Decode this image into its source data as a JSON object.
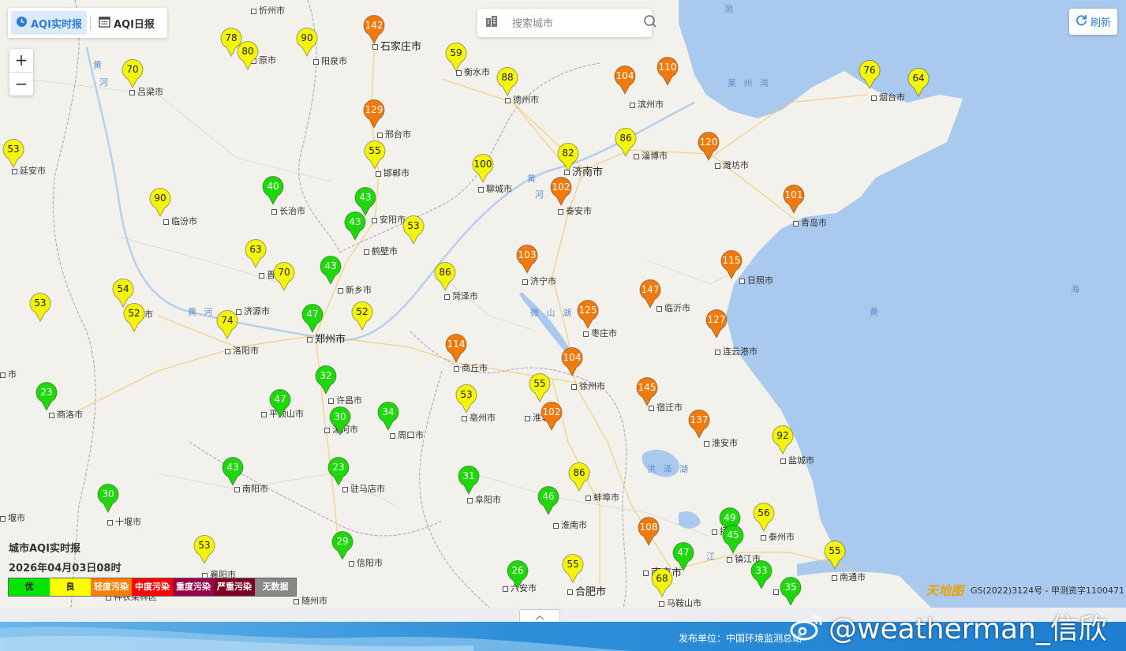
{
  "tabs": {
    "realtime": "AQI实时报",
    "daily": "AQI日报"
  },
  "search": {
    "placeholder": "搜索城市"
  },
  "refresh": "刷新",
  "legend": {
    "title": "城市AQI实时报",
    "time": "2026年04月03日08时",
    "levels": [
      {
        "label": "优",
        "color": "#00e400",
        "text": "#222"
      },
      {
        "label": "良",
        "color": "#ffff00",
        "text": "#222"
      },
      {
        "label": "轻度污染",
        "color": "#ff7e00",
        "text": "#fff"
      },
      {
        "label": "中度污染",
        "color": "#ff0000",
        "text": "#fff"
      },
      {
        "label": "重度污染",
        "color": "#99004c",
        "text": "#fff"
      },
      {
        "label": "严重污染",
        "color": "#7e0023",
        "text": "#fff"
      },
      {
        "label": "无数据",
        "color": "#888888",
        "text": "#fff"
      }
    ]
  },
  "level_colors": {
    "excellent": "#1ed80a",
    "good": "#f4f40a",
    "light": "#f27a0a"
  },
  "water_labels": [
    "渤",
    "莱 州 湾",
    "黄",
    "海",
    "黄",
    "河",
    "黄 河",
    "黄",
    "河",
    "微 山 湖",
    "洪 泽 湖",
    "江"
  ],
  "cities": [
    {
      "name": "忻州市",
      "big": false
    },
    {
      "name": "石家庄市",
      "big": true
    },
    {
      "name": "原市",
      "big": false
    },
    {
      "name": "阳泉市",
      "big": false
    },
    {
      "name": "衡水市",
      "big": false
    },
    {
      "name": "吕梁市",
      "big": false
    },
    {
      "name": "德州市",
      "big": false
    },
    {
      "name": "滨州市",
      "big": false
    },
    {
      "name": "烟台市",
      "big": false
    },
    {
      "name": "邢台市",
      "big": false
    },
    {
      "name": "延安市",
      "big": false
    },
    {
      "name": "淄博市",
      "big": false
    },
    {
      "name": "邯郸市",
      "big": false
    },
    {
      "name": "济南市",
      "big": true
    },
    {
      "name": "潍坊市",
      "big": false
    },
    {
      "name": "长治市",
      "big": false
    },
    {
      "name": "聊城市",
      "big": false
    },
    {
      "name": "临汾市",
      "big": false
    },
    {
      "name": "安阳市",
      "big": false
    },
    {
      "name": "泰安市",
      "big": false
    },
    {
      "name": "青岛市",
      "big": false
    },
    {
      "name": "鹤壁市",
      "big": false
    },
    {
      "name": "晋城",
      "big": false
    },
    {
      "name": "新乡市",
      "big": false
    },
    {
      "name": "济宁市",
      "big": false
    },
    {
      "name": "日照市",
      "big": false
    },
    {
      "name": "菏泽市",
      "big": false
    },
    {
      "name": "济源市",
      "big": false
    },
    {
      "name": "城市",
      "big": false
    },
    {
      "name": "临沂市",
      "big": false
    },
    {
      "name": "郑州市",
      "big": true
    },
    {
      "name": "洛阳市",
      "big": false
    },
    {
      "name": "枣庄市",
      "big": false
    },
    {
      "name": "连云港市",
      "big": false
    },
    {
      "name": "市",
      "big": false
    },
    {
      "name": "商丘市",
      "big": false
    },
    {
      "name": "徐州市",
      "big": false
    },
    {
      "name": "许昌市",
      "big": false
    },
    {
      "name": "商洛市",
      "big": false
    },
    {
      "name": "平顶山市",
      "big": false
    },
    {
      "name": "亳州市",
      "big": false
    },
    {
      "name": "淮北市",
      "big": false
    },
    {
      "name": "宿迁市",
      "big": false
    },
    {
      "name": "漯河市",
      "big": false
    },
    {
      "name": "周口市",
      "big": false
    },
    {
      "name": "淮安市",
      "big": false
    },
    {
      "name": "盐城市",
      "big": false
    },
    {
      "name": "南阳市",
      "big": false
    },
    {
      "name": "驻马店市",
      "big": false
    },
    {
      "name": "阜阳市",
      "big": false
    },
    {
      "name": "蚌埠市",
      "big": false
    },
    {
      "name": "十堰市",
      "big": false
    },
    {
      "name": "淮南市",
      "big": false
    },
    {
      "name": "扬州",
      "big": false
    },
    {
      "name": "泰州市",
      "big": false
    },
    {
      "name": "镇江市",
      "big": false
    },
    {
      "name": "信阳市",
      "big": false
    },
    {
      "name": "南京市",
      "big": true
    },
    {
      "name": "南通市",
      "big": false
    },
    {
      "name": "襄阳市",
      "big": false
    },
    {
      "name": "六安市",
      "big": false
    },
    {
      "name": "合肥市",
      "big": true
    },
    {
      "name": "常",
      "big": false
    },
    {
      "name": "神农架林区",
      "big": false
    },
    {
      "name": "随州市",
      "big": false
    },
    {
      "name": "马鞍山市",
      "big": false
    },
    {
      "name": "堰市",
      "big": false
    }
  ],
  "stations": [
    {
      "aqi": 142,
      "level": "light"
    },
    {
      "aqi": 78,
      "level": "good"
    },
    {
      "aqi": 80,
      "level": "good"
    },
    {
      "aqi": 90,
      "level": "good"
    },
    {
      "aqi": 59,
      "level": "good"
    },
    {
      "aqi": 70,
      "level": "good"
    },
    {
      "aqi": 88,
      "level": "good"
    },
    {
      "aqi": 104,
      "level": "light"
    },
    {
      "aqi": 110,
      "level": "light"
    },
    {
      "aqi": 76,
      "level": "good"
    },
    {
      "aqi": 64,
      "level": "good"
    },
    {
      "aqi": 129,
      "level": "light"
    },
    {
      "aqi": 53,
      "level": "good"
    },
    {
      "aqi": 55,
      "level": "good"
    },
    {
      "aqi": 86,
      "level": "good"
    },
    {
      "aqi": 82,
      "level": "good"
    },
    {
      "aqi": 120,
      "level": "light"
    },
    {
      "aqi": 100,
      "level": "good"
    },
    {
      "aqi": 40,
      "level": "excellent"
    },
    {
      "aqi": 102,
      "level": "light"
    },
    {
      "aqi": 90,
      "level": "good"
    },
    {
      "aqi": 43,
      "level": "excellent"
    },
    {
      "aqi": 101,
      "level": "light"
    },
    {
      "aqi": 43,
      "level": "excellent"
    },
    {
      "aqi": 53,
      "level": "good"
    },
    {
      "aqi": 63,
      "level": "good"
    },
    {
      "aqi": 103,
      "level": "light"
    },
    {
      "aqi": 115,
      "level": "light"
    },
    {
      "aqi": 70,
      "level": "good"
    },
    {
      "aqi": 43,
      "level": "excellent"
    },
    {
      "aqi": 86,
      "level": "good"
    },
    {
      "aqi": 147,
      "level": "light"
    },
    {
      "aqi": 54,
      "level": "good"
    },
    {
      "aqi": 53,
      "level": "good"
    },
    {
      "aqi": 52,
      "level": "good"
    },
    {
      "aqi": 125,
      "level": "light"
    },
    {
      "aqi": 74,
      "level": "good"
    },
    {
      "aqi": 47,
      "level": "excellent"
    },
    {
      "aqi": 52,
      "level": "good"
    },
    {
      "aqi": 127,
      "level": "light"
    },
    {
      "aqi": 114,
      "level": "light"
    },
    {
      "aqi": 104,
      "level": "light"
    },
    {
      "aqi": 32,
      "level": "excellent"
    },
    {
      "aqi": 55,
      "level": "good"
    },
    {
      "aqi": 145,
      "level": "light"
    },
    {
      "aqi": 23,
      "level": "excellent"
    },
    {
      "aqi": 47,
      "level": "excellent"
    },
    {
      "aqi": 53,
      "level": "good"
    },
    {
      "aqi": 102,
      "level": "light"
    },
    {
      "aqi": 30,
      "level": "excellent"
    },
    {
      "aqi": 34,
      "level": "excellent"
    },
    {
      "aqi": 137,
      "level": "light"
    },
    {
      "aqi": 92,
      "level": "good"
    },
    {
      "aqi": 43,
      "level": "excellent"
    },
    {
      "aqi": 23,
      "level": "excellent"
    },
    {
      "aqi": 31,
      "level": "excellent"
    },
    {
      "aqi": 86,
      "level": "good"
    },
    {
      "aqi": 30,
      "level": "excellent"
    },
    {
      "aqi": 46,
      "level": "excellent"
    },
    {
      "aqi": 49,
      "level": "excellent"
    },
    {
      "aqi": 56,
      "level": "good"
    },
    {
      "aqi": 108,
      "level": "light"
    },
    {
      "aqi": 45,
      "level": "excellent"
    },
    {
      "aqi": 53,
      "level": "good"
    },
    {
      "aqi": 29,
      "level": "excellent"
    },
    {
      "aqi": 47,
      "level": "excellent"
    },
    {
      "aqi": 55,
      "level": "good"
    },
    {
      "aqi": 26,
      "level": "excellent"
    },
    {
      "aqi": 55,
      "level": "good"
    },
    {
      "aqi": 33,
      "level": "excellent"
    },
    {
      "aqi": 68,
      "level": "good"
    },
    {
      "aqi": 35,
      "level": "excellent"
    }
  ],
  "copyright": "GS(2022)3124号 - 甲测资字1100471",
  "tianditu": "天地图",
  "footer": {
    "publisher": "发布单位：中国环境监测总站",
    "watermark": "@weatherman_信欣"
  }
}
